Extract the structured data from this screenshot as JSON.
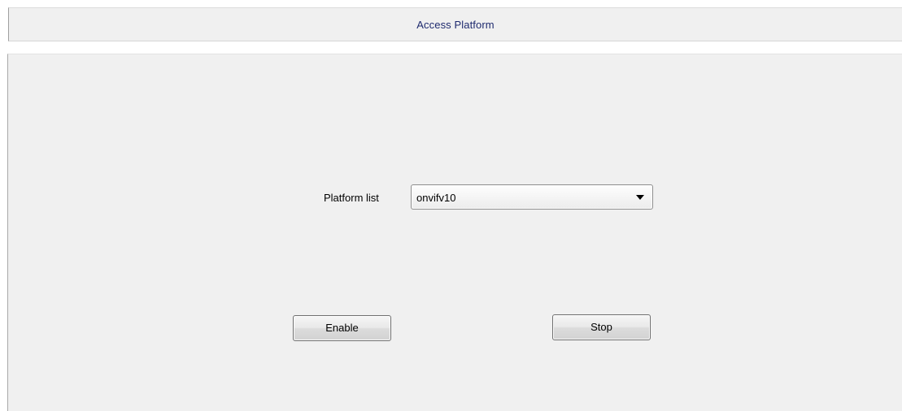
{
  "window": {
    "title": "Access Platform"
  },
  "form": {
    "platform_label": "Platform list",
    "platform_selected": "onvifv10"
  },
  "actions": {
    "enable_label": "Enable",
    "stop_label": "Stop"
  },
  "icons": {
    "dropdown": "chevron-down-icon"
  }
}
